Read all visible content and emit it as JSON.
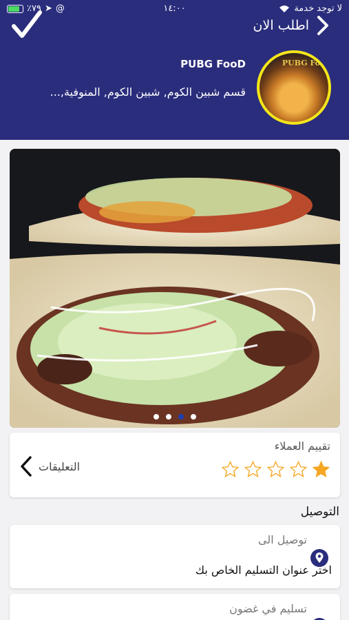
{
  "status_bar": {
    "carrier": "لا توجد خدمة",
    "time": "١٤:٠٠",
    "battery": "٪٧٩"
  },
  "header": {
    "order_now_label": "اطلب الان",
    "store_name": "PUBG FooD",
    "store_areas": "قسم شبين الكوم, شبين الكوم, المنوفية,...",
    "logo_text": "PUBG Fo",
    "bg_color": "#2a2d7c"
  },
  "carousel": {
    "dot_count": 4,
    "active_index": 2
  },
  "rating": {
    "title": "تقييم العملاء",
    "value": 1,
    "max": 5,
    "comments_label": "التعليقات",
    "star_color": "#f5a623"
  },
  "delivery": {
    "section_title": "التوصيل",
    "deliver_to_label": "توصيل الى",
    "address_placeholder": "اختر عنوان التسليم الخاص بك",
    "delivery_time_label": "تسليم في غضون",
    "icon_color": "#2a2d7c"
  }
}
